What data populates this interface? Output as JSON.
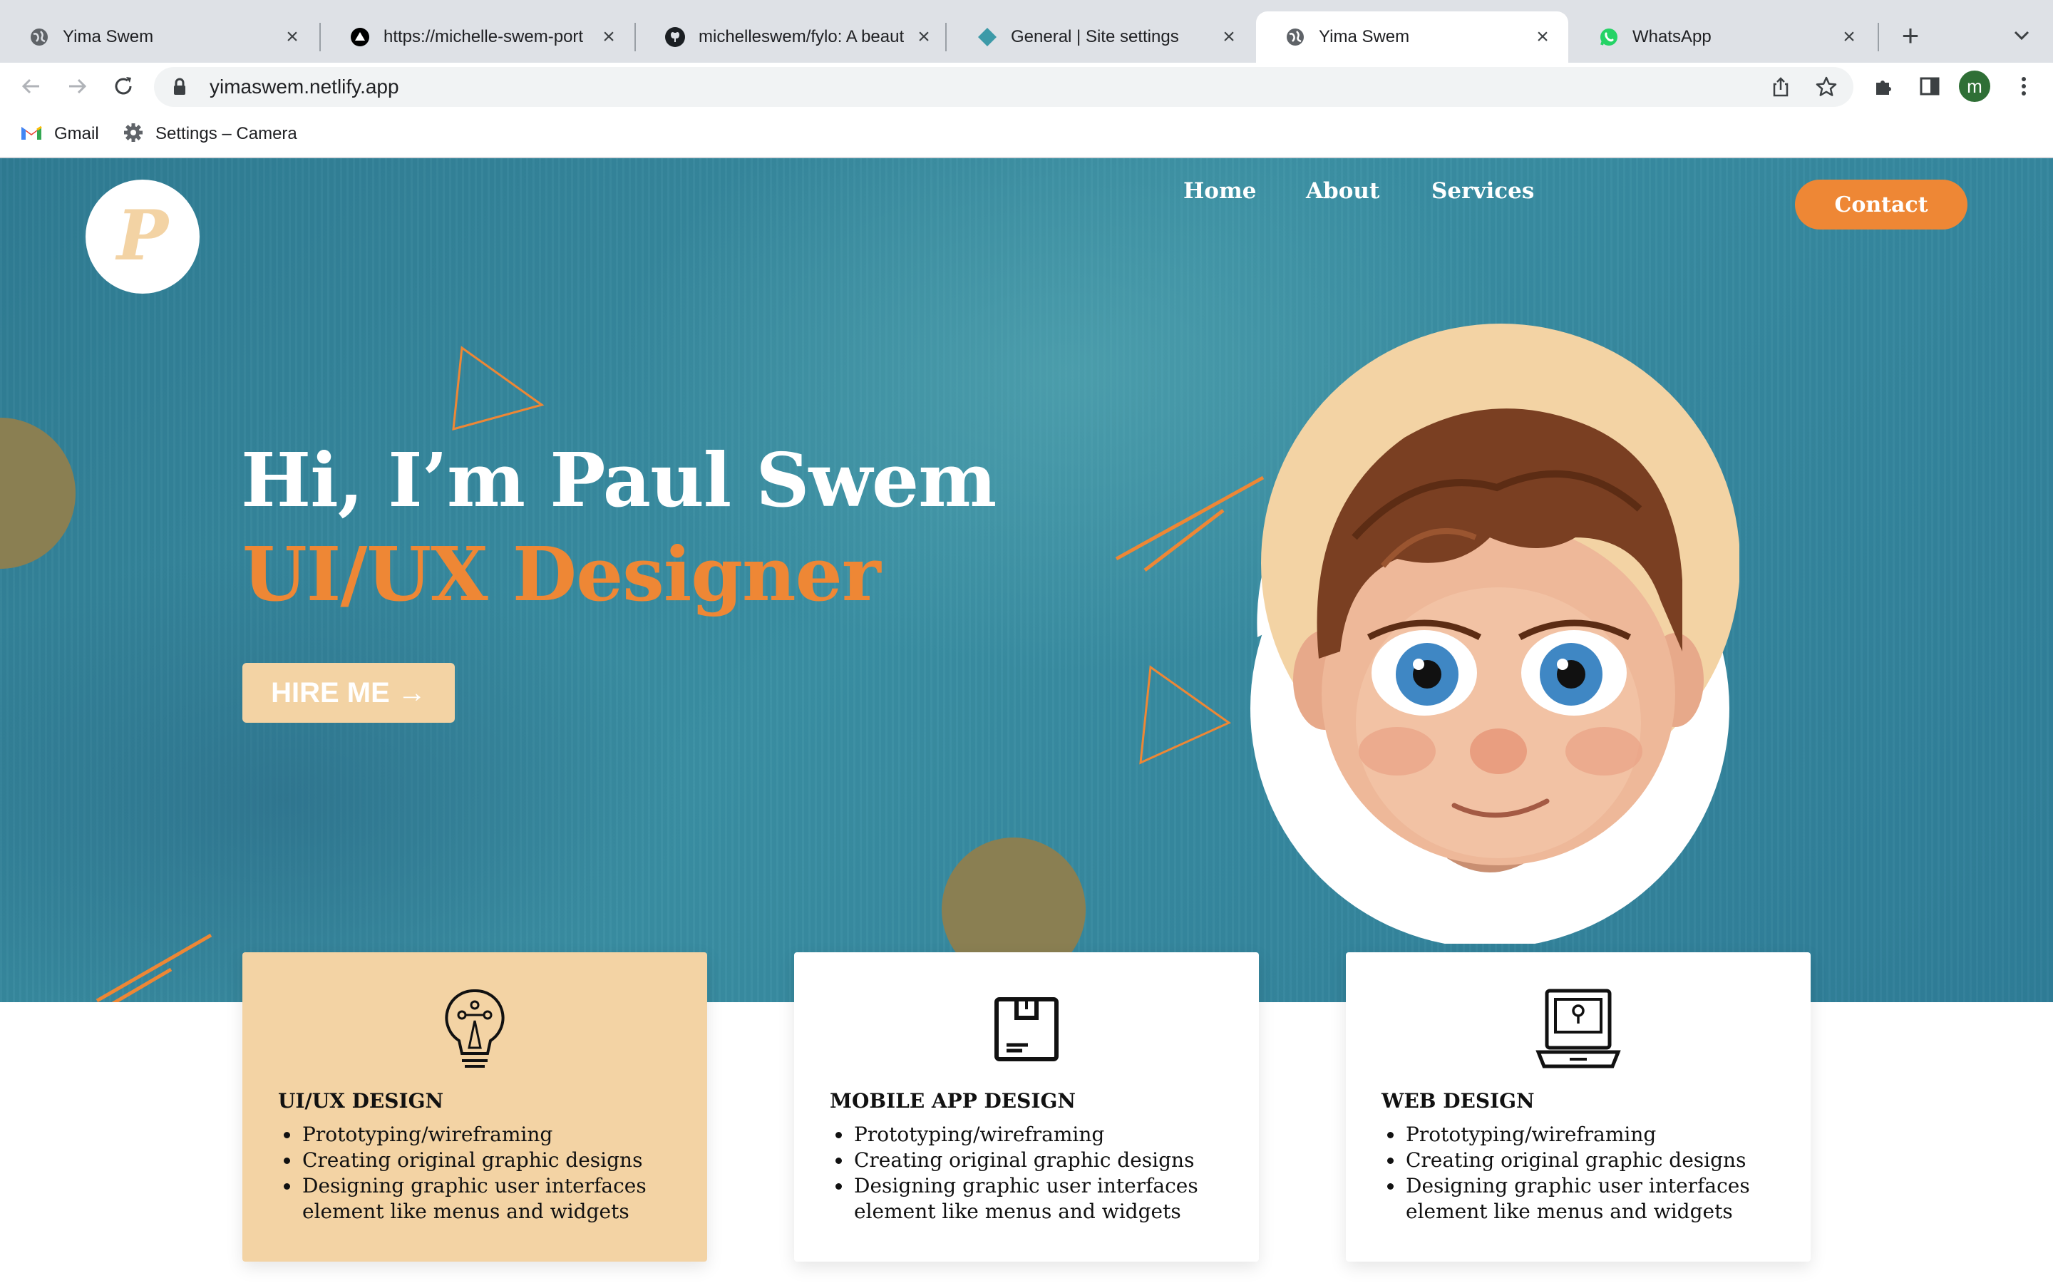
{
  "browser": {
    "tabs": [
      {
        "title": "Yima Swem",
        "icon": "globe-icon",
        "active": false
      },
      {
        "title": "https://michelle-swem-port",
        "icon": "vercel-icon",
        "active": false
      },
      {
        "title": "michelleswem/fylo: A beaut",
        "icon": "github-icon",
        "active": false
      },
      {
        "title": "General | Site settings",
        "icon": "netlify-icon",
        "active": false
      },
      {
        "title": "Yima Swem",
        "icon": "globe-icon",
        "active": true
      },
      {
        "title": "WhatsApp",
        "icon": "whatsapp-icon",
        "active": false
      }
    ],
    "url": "yimaswem.netlify.app",
    "profile_initial": "m",
    "bookmarks": [
      {
        "label": "Gmail",
        "icon": "gmail-icon"
      },
      {
        "label": "Settings – Camera",
        "icon": "gear-icon"
      }
    ]
  },
  "site": {
    "logo_letter": "P",
    "nav": {
      "home": "Home",
      "about": "About",
      "services": "Services",
      "contact": "Contact"
    },
    "hero": {
      "greeting": "Hi, I’m Paul Swem",
      "role": "UI/UX Designer",
      "cta": "HIRE ME →"
    },
    "services": [
      {
        "title": "UI/UX DESIGN",
        "icon": "lightbulb-pen-icon",
        "items": [
          "Prototyping/wireframing",
          "Creating original graphic designs",
          "Designing graphic user interfaces element like menus and widgets"
        ]
      },
      {
        "title": "MOBILE APP DESIGN",
        "icon": "box-app-icon",
        "items": [
          "Prototyping/wireframing",
          "Creating original graphic designs",
          "Designing graphic user interfaces element like menus and widgets"
        ]
      },
      {
        "title": "WEB DESIGN",
        "icon": "laptop-lock-icon",
        "items": [
          "Prototyping/wireframing",
          "Creating original graphic designs",
          "Designing graphic user interfaces element like menus and widgets"
        ]
      }
    ]
  },
  "colors": {
    "accent_orange": "#ee8735",
    "peach": "#f3d3a4",
    "hero_teal": "#3a8fa3",
    "olive_circle": "#8a7f52"
  }
}
